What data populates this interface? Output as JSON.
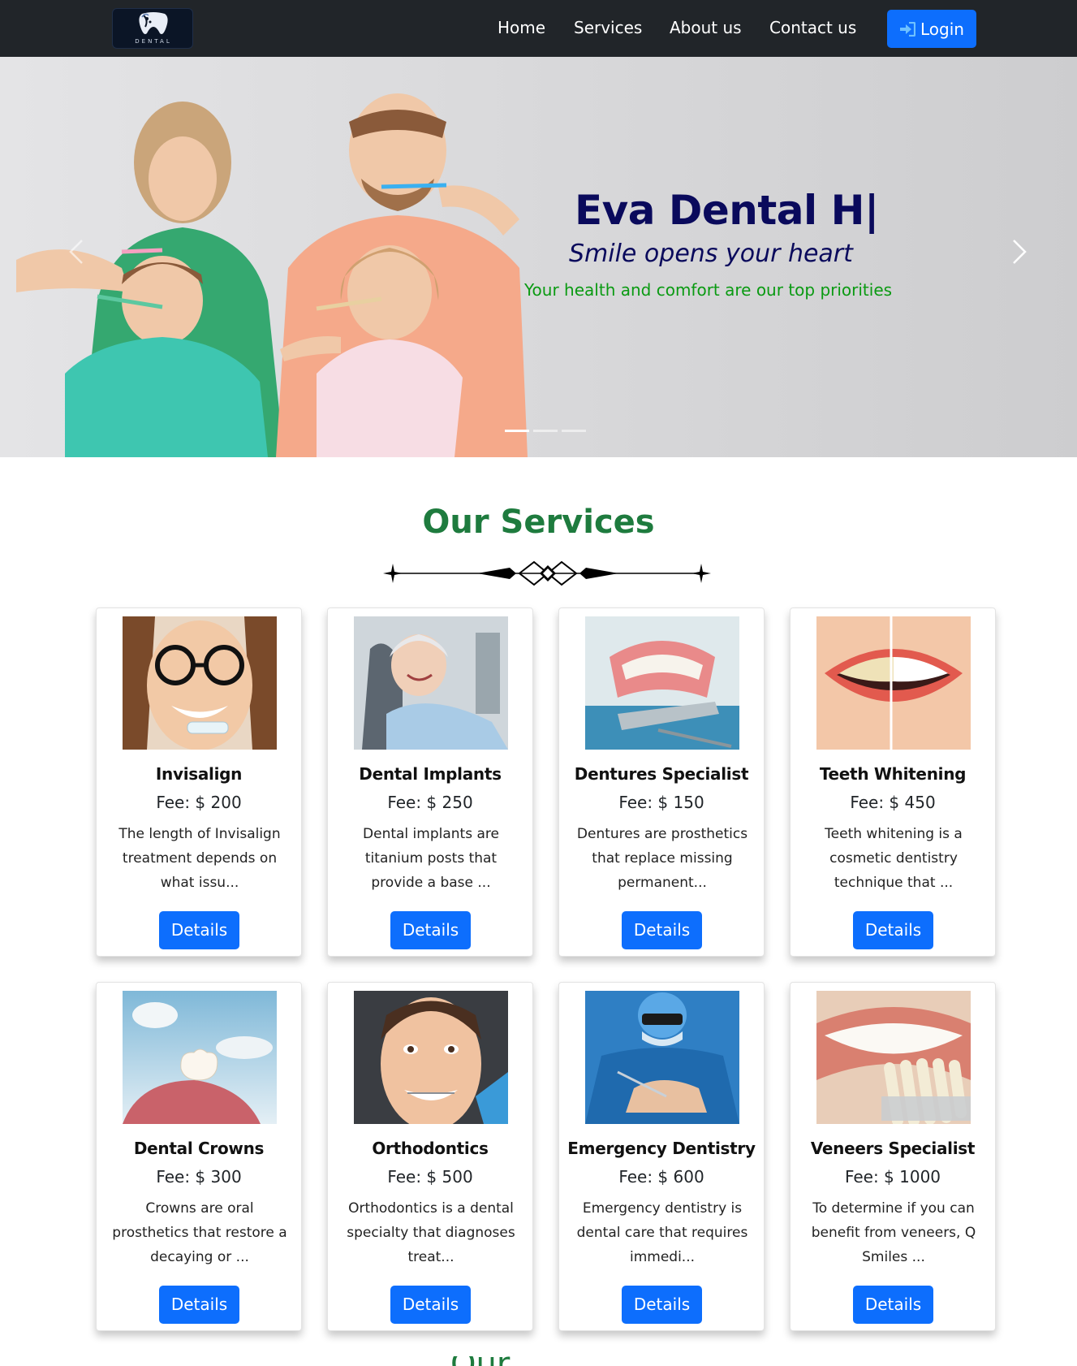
{
  "nav": {
    "logo_text": "DENTAL",
    "links": [
      "Home",
      "Services",
      "About us",
      "Contact us"
    ],
    "login_label": "Login"
  },
  "hero": {
    "title": "Eva Dental H|",
    "subtitle": "Smile opens your heart",
    "tagline": "Your health and comfort are our top priorities",
    "slide_count": 3,
    "active_slide": 1
  },
  "services": {
    "title": "Our Services",
    "details_label": "Details",
    "items": [
      {
        "name": "Invisalign",
        "fee": "Fee: $ 200",
        "desc": "The length of Invisalign treatment depends on what issu..."
      },
      {
        "name": "Dental Implants",
        "fee": "Fee: $ 250",
        "desc": "Dental implants are titanium posts that provide a base ..."
      },
      {
        "name": "Dentures Specialist",
        "fee": "Fee: $ 150",
        "desc": "Dentures are prosthetics that replace missing permanent..."
      },
      {
        "name": "Teeth Whitening",
        "fee": "Fee: $ 450",
        "desc": "Teeth whitening is a cosmetic dentistry technique that ..."
      },
      {
        "name": "Dental Crowns",
        "fee": "Fee: $ 300",
        "desc": "Crowns are oral prosthetics that restore a decaying or ..."
      },
      {
        "name": "Orthodontics",
        "fee": "Fee: $ 500",
        "desc": "Orthodontics is a dental specialty that diagnoses treat..."
      },
      {
        "name": "Emergency Dentistry",
        "fee": "Fee: $ 600",
        "desc": "Emergency dentistry is dental care that requires immedi..."
      },
      {
        "name": "Veneers Specialist",
        "fee": "Fee: $ 1000",
        "desc": "To determine if you can benefit from veneers, Q Smiles ..."
      }
    ]
  },
  "next_section_title": "Our Doctors",
  "colors": {
    "navbar": "#212529",
    "primary": "#0d6efd",
    "hero_title": "#0a0a5c",
    "tagline": "#0a9a12",
    "section_title": "#1e7b3e"
  }
}
